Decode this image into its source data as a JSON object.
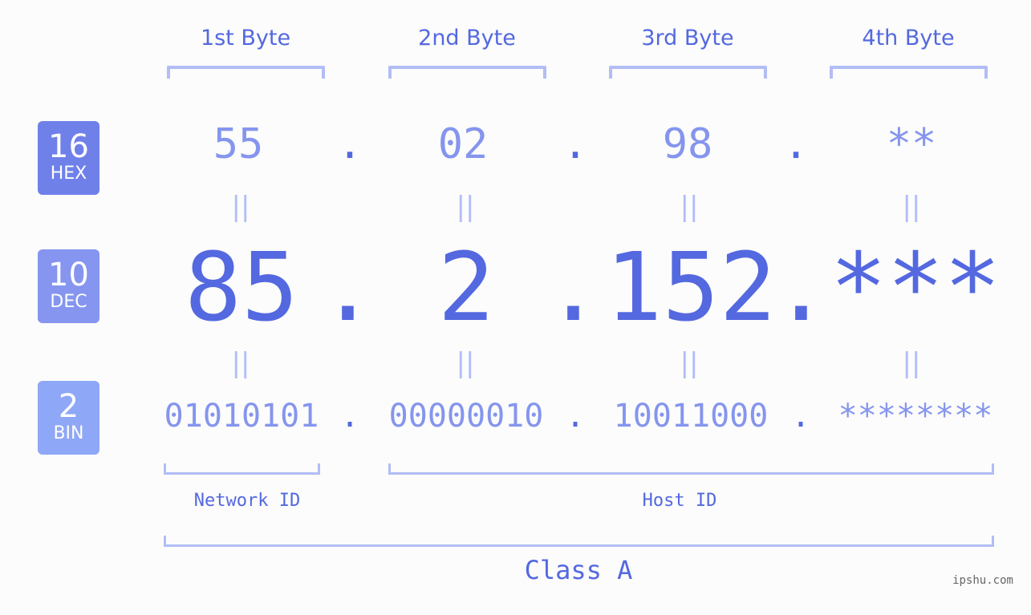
{
  "headers": [
    "1st Byte",
    "2nd Byte",
    "3rd Byte",
    "4th Byte"
  ],
  "badges": [
    {
      "num": "16",
      "label": "HEX",
      "color": "#6f80e9"
    },
    {
      "num": "10",
      "label": "DEC",
      "color": "#8595f0"
    },
    {
      "num": "2",
      "label": "BIN",
      "color": "#8fa7f7"
    }
  ],
  "hex": [
    "55",
    "02",
    "98",
    "**"
  ],
  "dec": [
    "85",
    "2",
    "152",
    "***"
  ],
  "bin": [
    "01010101",
    "00000010",
    "10011000",
    "********"
  ],
  "separator": ".",
  "equals": "||",
  "network_id_label": "Network ID",
  "host_id_label": "Host ID",
  "class_label": "Class A",
  "watermark": "ipshu.com",
  "colors": {
    "accent": "#5468e0",
    "light": "#8595ee",
    "bracket": "#b2bdf6"
  }
}
